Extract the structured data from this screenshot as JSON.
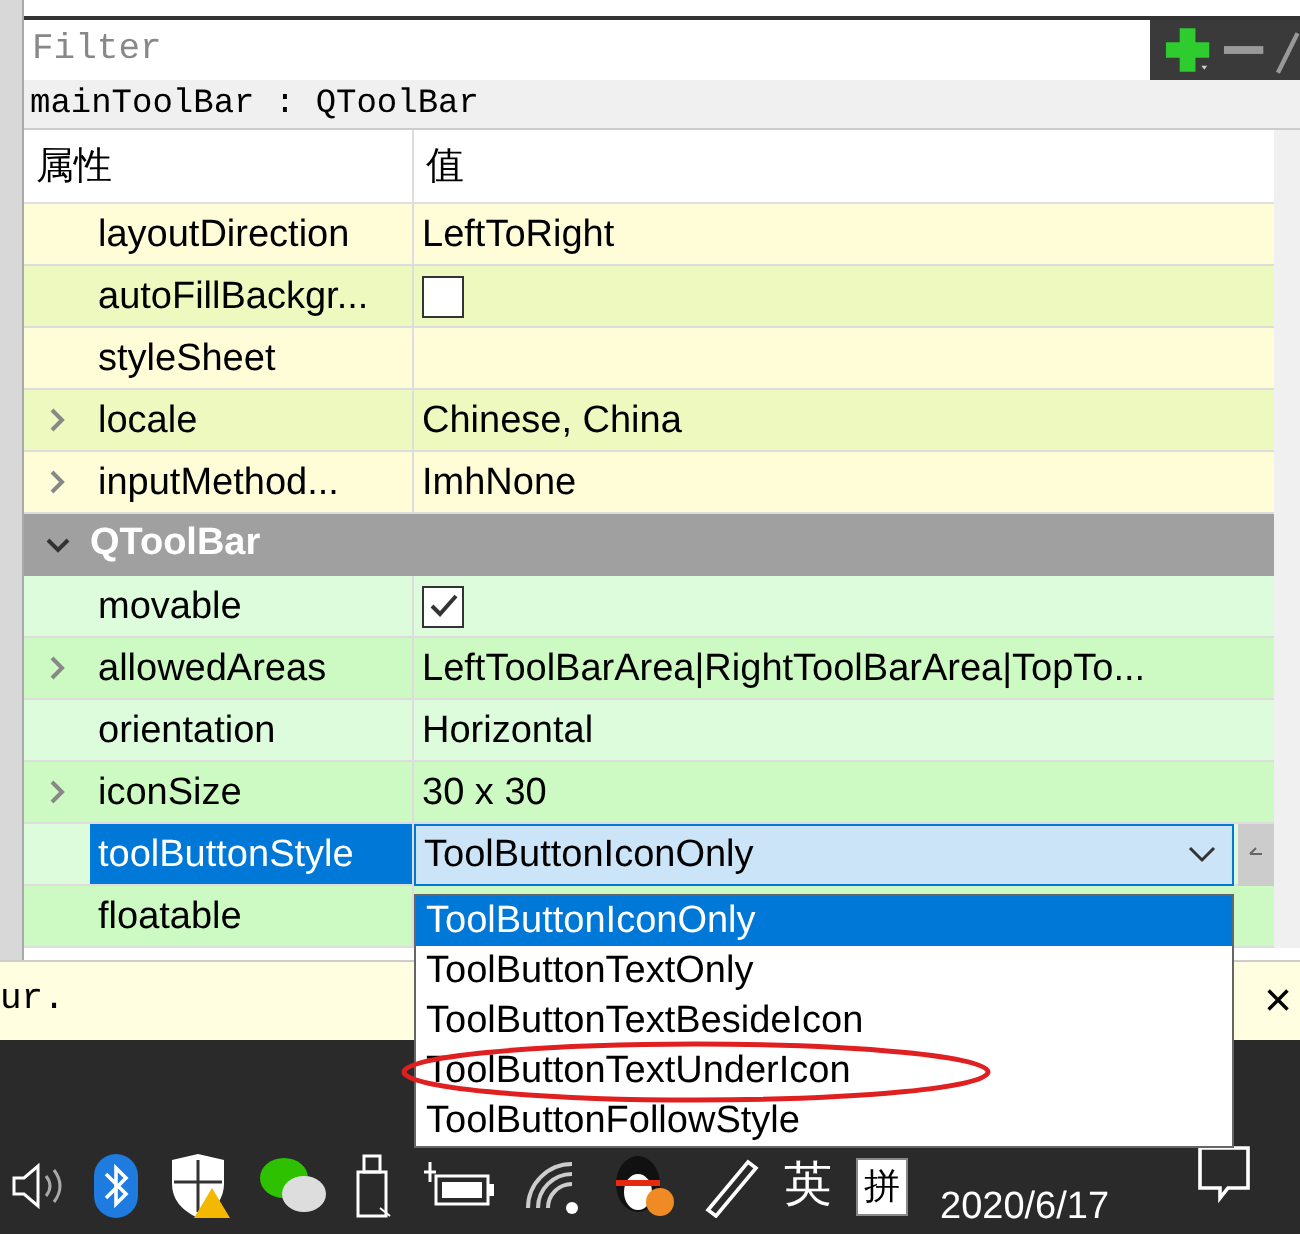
{
  "filter": {
    "placeholder": "Filter"
  },
  "object_title": "mainToolBar : QToolBar",
  "columns": [
    "属性",
    "值"
  ],
  "sections": [
    {
      "color": "#fffcd8",
      "rows": [
        {
          "kind": "text",
          "name": "layoutDirection",
          "value": "LeftToRight",
          "expandable": false,
          "selected": false
        },
        {
          "kind": "checkbox",
          "name": "autoFillBackgr...",
          "checked": false,
          "expandable": false,
          "selected": false
        },
        {
          "kind": "text",
          "name": "styleSheet",
          "value": "",
          "expandable": false,
          "selected": false
        },
        {
          "kind": "text",
          "name": "locale",
          "value": "Chinese, China",
          "expandable": true,
          "selected": false
        },
        {
          "kind": "text",
          "name": "inputMethod...",
          "value": "ImhNone",
          "expandable": true,
          "selected": false
        }
      ]
    },
    {
      "title": "QToolBar",
      "expanded": true,
      "color": "#dcfcdc",
      "rows": [
        {
          "kind": "checkbox",
          "name": "movable",
          "checked": true,
          "expandable": false,
          "selected": false
        },
        {
          "kind": "text",
          "name": "allowedAreas",
          "value": "LeftToolBarArea|RightToolBarArea|TopTo...",
          "expandable": true,
          "selected": false
        },
        {
          "kind": "text",
          "name": "orientation",
          "value": "Horizontal",
          "expandable": false,
          "selected": false
        },
        {
          "kind": "text",
          "name": "iconSize",
          "value": "30 x 30",
          "expandable": true,
          "selected": false
        },
        {
          "kind": "combo",
          "name": "toolButtonStyle",
          "value": "ToolButtonIconOnly",
          "expandable": false,
          "selected": true
        },
        {
          "kind": "text",
          "name": "floatable",
          "value": "",
          "expandable": false,
          "selected": false
        }
      ]
    }
  ],
  "dropdown": {
    "options": [
      {
        "label": "ToolButtonIconOnly",
        "selected": true,
        "circled": false
      },
      {
        "label": "ToolButtonTextOnly",
        "selected": false,
        "circled": false
      },
      {
        "label": "ToolButtonTextBesideIcon",
        "selected": false,
        "circled": false
      },
      {
        "label": "ToolButtonTextUnderIcon",
        "selected": false,
        "circled": true
      },
      {
        "label": "ToolButtonFollowStyle",
        "selected": false,
        "circled": false
      }
    ]
  },
  "message_bar": {
    "text": "ur.",
    "close": "×"
  },
  "taskbar": {
    "ime_language": "英",
    "ime_mode": "拼",
    "date": "2020/6/17"
  }
}
